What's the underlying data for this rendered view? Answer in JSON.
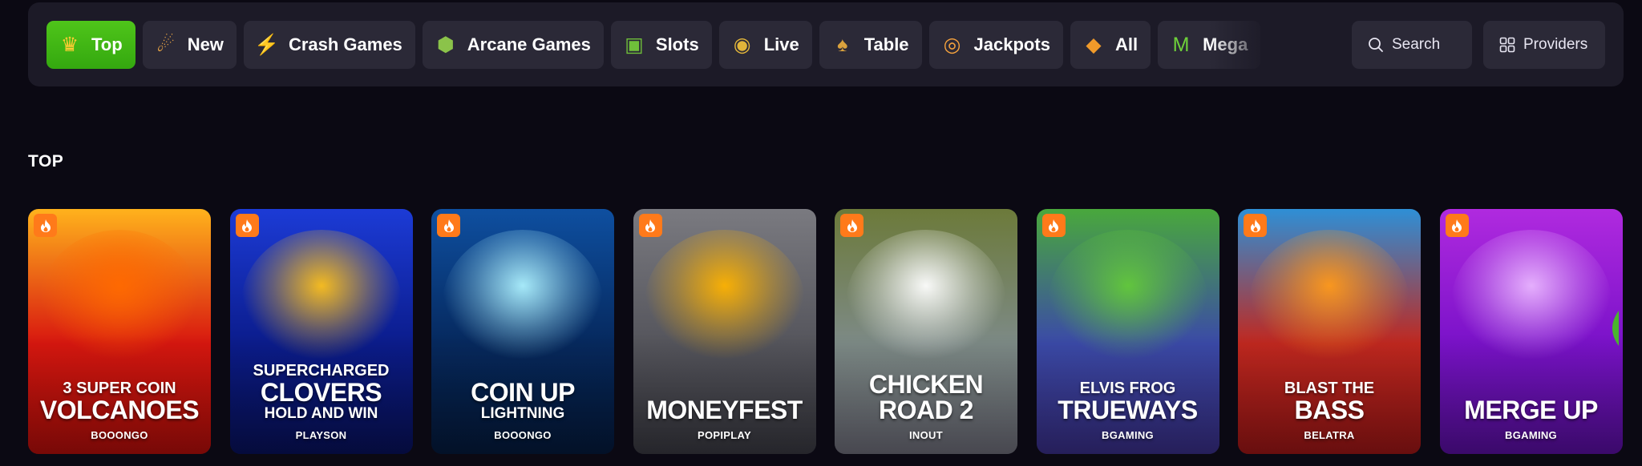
{
  "categories": [
    {
      "label": "Top",
      "icon": "crown-flame-icon",
      "glyph": "♛",
      "color": "#ffcc33",
      "active": true
    },
    {
      "label": "New",
      "icon": "comet-icon",
      "glyph": "☄",
      "color": "#ffb347"
    },
    {
      "label": "Crash Games",
      "icon": "lightning-icon",
      "glyph": "⚡",
      "color": "#ffd21f"
    },
    {
      "label": "Arcane Games",
      "icon": "dice-cube-icon",
      "glyph": "⬢",
      "color": "#8bc34a"
    },
    {
      "label": "Slots",
      "icon": "slot-machine-icon",
      "glyph": "▣",
      "color": "#6fbf3a"
    },
    {
      "label": "Live",
      "icon": "coins-stack-icon",
      "glyph": "◉",
      "color": "#e0b43a"
    },
    {
      "label": "Table",
      "icon": "playing-cards-icon",
      "glyph": "♠",
      "color": "#d9a13d"
    },
    {
      "label": "Jackpots",
      "icon": "jackpot-coins-icon",
      "glyph": "◎",
      "color": "#f2a03d"
    },
    {
      "label": "All",
      "icon": "cubes-icon",
      "glyph": "◆",
      "color": "#f09a2a"
    },
    {
      "label": "Mega",
      "icon": "mega-m-icon",
      "glyph": "M",
      "color": "#6ed13a"
    }
  ],
  "search_label": "Search",
  "providers_label": "Providers",
  "section_title": "TOP",
  "games": [
    {
      "pre": "3 Super Coin",
      "main": "Volcanoes",
      "post": "",
      "provider": "BOOONGO",
      "c1": "#ffb21c",
      "c2": "#d8170f",
      "c3": "#b80e0a",
      "glow": "#ff6a00"
    },
    {
      "pre": "Supercharged",
      "main": "Clovers",
      "post": "Hold and Win",
      "provider": "PLAYSON",
      "c1": "#1c3bd6",
      "c2": "#0b1c8c",
      "c3": "#08115c",
      "glow": "#ffc21a"
    },
    {
      "pre": "",
      "main": "Coin Up",
      "post": "Lightning",
      "provider": "BOOONGO",
      "c1": "#0e4fa0",
      "c2": "#06295e",
      "c3": "#041a3d",
      "glow": "#aef2ff"
    },
    {
      "pre": "",
      "main": "Moneyfest",
      "post": "",
      "provider": "POPIPLAY",
      "c1": "#7a7a80",
      "c2": "#55555c",
      "c3": "#3a3a42",
      "glow": "#ffb300"
    },
    {
      "pre": "",
      "main": "Chicken Road 2",
      "post": "",
      "provider": "INOUT",
      "c1": "#6c7a3a",
      "c2": "#7d8a86",
      "c3": "#6e6e7a",
      "glow": "#ffffff"
    },
    {
      "pre": "Elvis Frog",
      "main": "Trueways",
      "post": "",
      "provider": "BGAMING",
      "c1": "#49a83c",
      "c2": "#3b4aa8",
      "c3": "#3a2f8a",
      "glow": "#63c93a"
    },
    {
      "pre": "Blast the",
      "main": "Bass",
      "post": "",
      "provider": "BELATRA",
      "c1": "#2e8fd6",
      "c2": "#c1281f",
      "c3": "#a01616",
      "glow": "#ff9a1a"
    },
    {
      "pre": "",
      "main": "Merge Up",
      "post": "",
      "provider": "BGAMING",
      "c1": "#b02adf",
      "c2": "#7a12c9",
      "c3": "#5a0fa3",
      "glow": "#e9b6ff"
    }
  ]
}
